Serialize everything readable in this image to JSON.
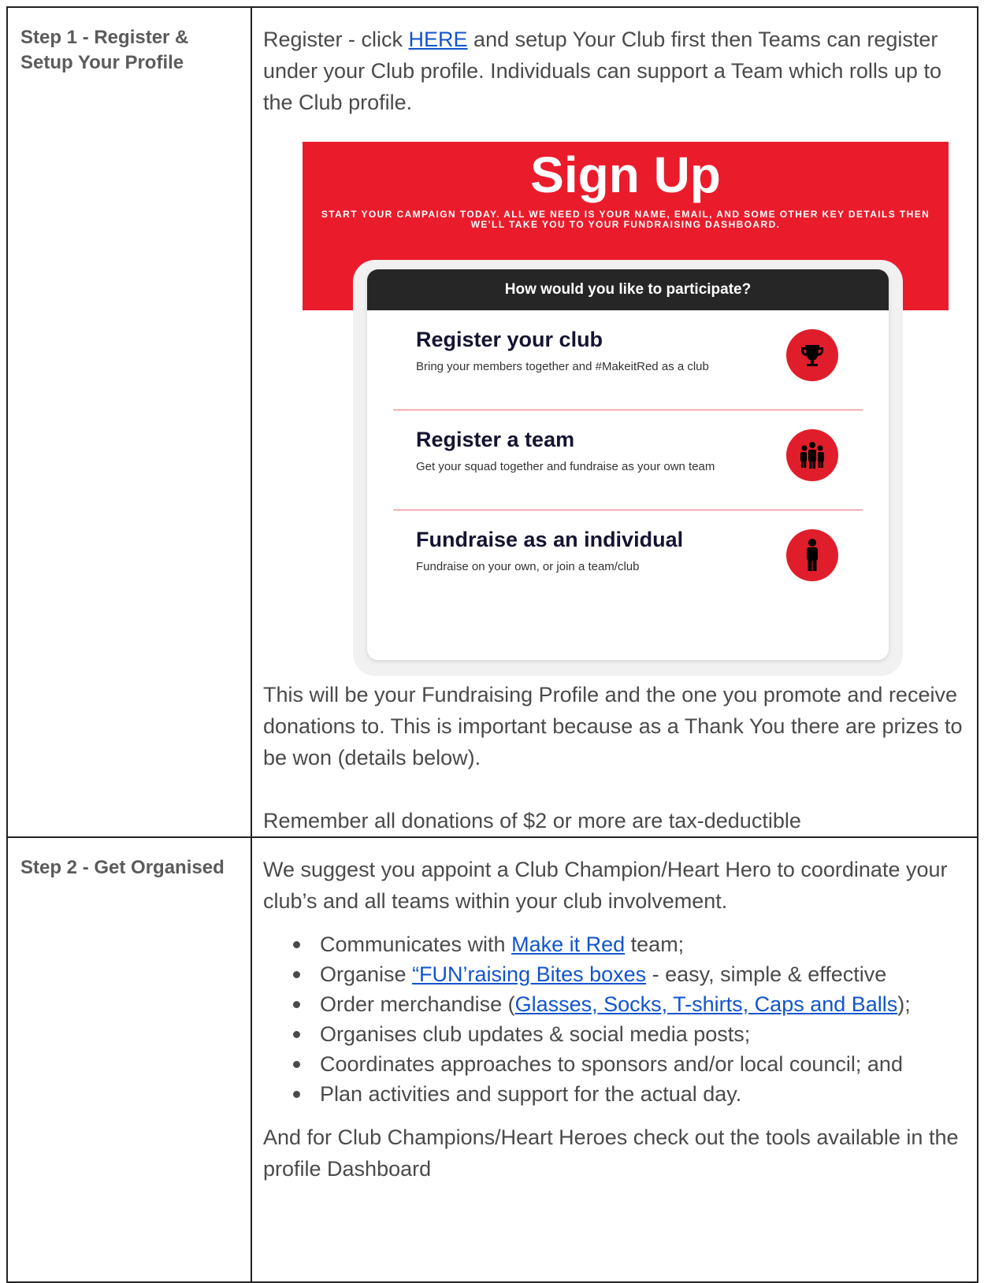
{
  "step1": {
    "label": "Step 1 - Register & Setup Your Profile",
    "intro_before": "Register - click ",
    "intro_link": "HERE",
    "intro_after": " and setup Your Club first then Teams can register under your Club profile. Individuals can support a Team which rolls up to the Club profile.",
    "graphic": {
      "title": "Sign Up",
      "tagline": "START YOUR CAMPAIGN TODAY. ALL WE NEED IS YOUR NAME, EMAIL, AND SOME OTHER KEY DETAILS THEN WE'LL TAKE YOU TO YOUR FUNDRAISING DASHBOARD.",
      "card_heading": "How would you like to participate?",
      "options": [
        {
          "title": "Register your club",
          "subtitle": "Bring your members together and #MakeitRed as a club",
          "icon": "trophy-icon"
        },
        {
          "title": "Register a team",
          "subtitle": "Get your squad together and fundraise as your own team",
          "icon": "team-icon"
        },
        {
          "title": "Fundraise as an individual",
          "subtitle": "Fundraise on your own, or join a team/club",
          "icon": "person-icon"
        }
      ],
      "colors": {
        "banner": "#ea1c2c",
        "card_header": "#262626",
        "icon_bg": "#e01e2b"
      }
    },
    "after_text": "This will be your Fundraising Profile and the one you promote and receive donations to. This is important because as a Thank You there are prizes to be won (details below).",
    "tax_note": "Remember all donations of $2 or more are tax-deductible"
  },
  "step2": {
    "label": "Step 2 - Get Organised",
    "intro": "We suggest you appoint a Club Champion/Heart Hero to coordinate your club’s and all teams within your club involvement.",
    "bullets": [
      {
        "before": "Communicates with ",
        "link": "Make it Red",
        "after": " team;"
      },
      {
        "before": "Organise ",
        "link": "“FUN’raising Bites boxes",
        "after": " - easy, simple & effective"
      },
      {
        "before": "Order merchandise (",
        "link": "Glasses, Socks, T-shirts, Caps and Balls",
        "after": ");"
      },
      {
        "text": "Organises club updates & social media posts;"
      },
      {
        "text": "Coordinates approaches to sponsors and/or local council; and"
      },
      {
        "text": "Plan activities and support for the actual day."
      }
    ],
    "outro": "And for Club Champions/Heart Heroes check out the tools available in the profile Dashboard"
  },
  "colors": {
    "link": "#1155cc",
    "text": "#4a4a4a"
  }
}
